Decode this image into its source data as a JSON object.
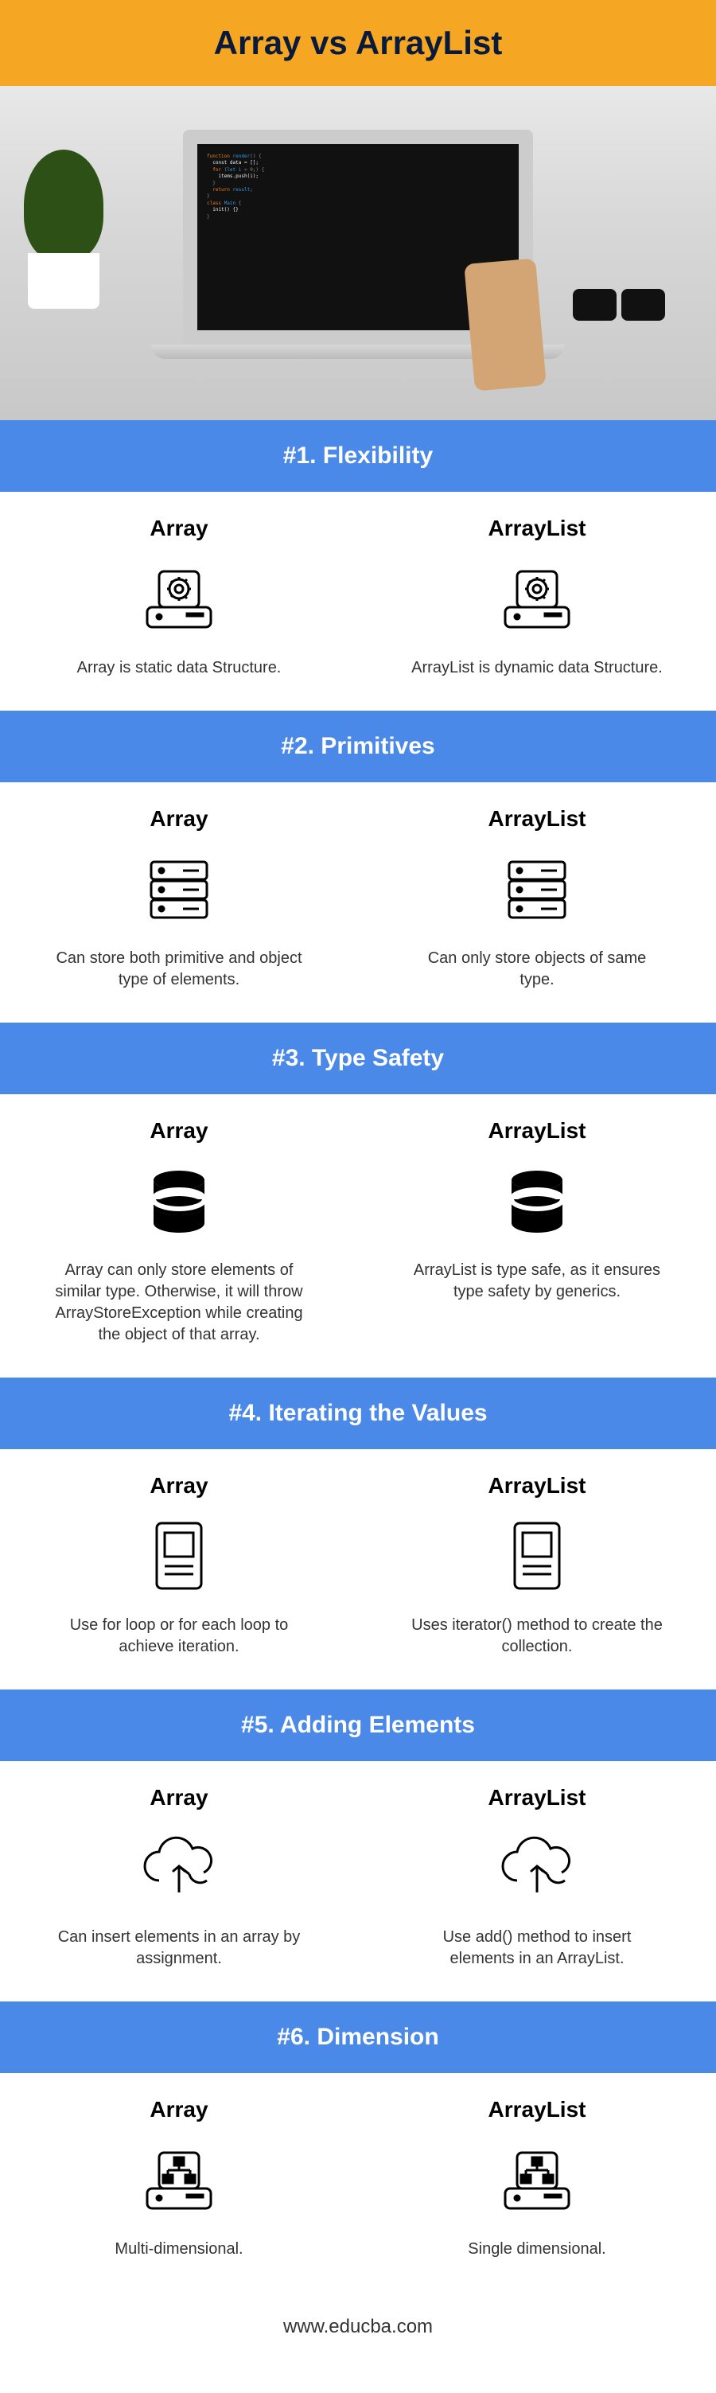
{
  "header": {
    "title": "Array vs ArrayList"
  },
  "sections": [
    {
      "band": "#1. Flexibility",
      "left": {
        "title": "Array",
        "desc": "Array is static data Structure.",
        "icon": "drive-gear"
      },
      "right": {
        "title": "ArrayList",
        "desc": "ArrayList is dynamic data Structure.",
        "icon": "drive-gear"
      }
    },
    {
      "band": "#2. Primitives",
      "left": {
        "title": "Array",
        "desc": "Can store both primitive and object type of elements.",
        "icon": "stack-bars"
      },
      "right": {
        "title": "ArrayList",
        "desc": "Can only store objects of same type.",
        "icon": "stack-bars"
      }
    },
    {
      "band": "#3. Type Safety",
      "left": {
        "title": "Array",
        "desc": "Array can only store elements of similar type. Otherwise, it will throw ArrayStoreException while creating the object of that array.",
        "icon": "database"
      },
      "right": {
        "title": "ArrayList",
        "desc": "ArrayList is type safe, as it ensures type safety by generics.",
        "icon": "database"
      }
    },
    {
      "band": "#4. Iterating the Values",
      "left": {
        "title": "Array",
        "desc": "Use for loop or for each loop to achieve iteration.",
        "icon": "tablet"
      },
      "right": {
        "title": "ArrayList",
        "desc": "Uses iterator() method to create the collection.",
        "icon": "tablet"
      }
    },
    {
      "band": "#5. Adding Elements",
      "left": {
        "title": "Array",
        "desc": "Can insert elements in an array by assignment.",
        "icon": "cloud-arrow"
      },
      "right": {
        "title": "ArrayList",
        "desc": "Use add() method to insert elements in an ArrayList.",
        "icon": "cloud-arrow"
      }
    },
    {
      "band": "#6. Dimension",
      "left": {
        "title": "Array",
        "desc": "Multi-dimensional.",
        "icon": "drive-nodes"
      },
      "right": {
        "title": "ArrayList",
        "desc": "Single dimensional.",
        "icon": "drive-nodes"
      }
    }
  ],
  "footer": {
    "url": "www.educba.com"
  }
}
